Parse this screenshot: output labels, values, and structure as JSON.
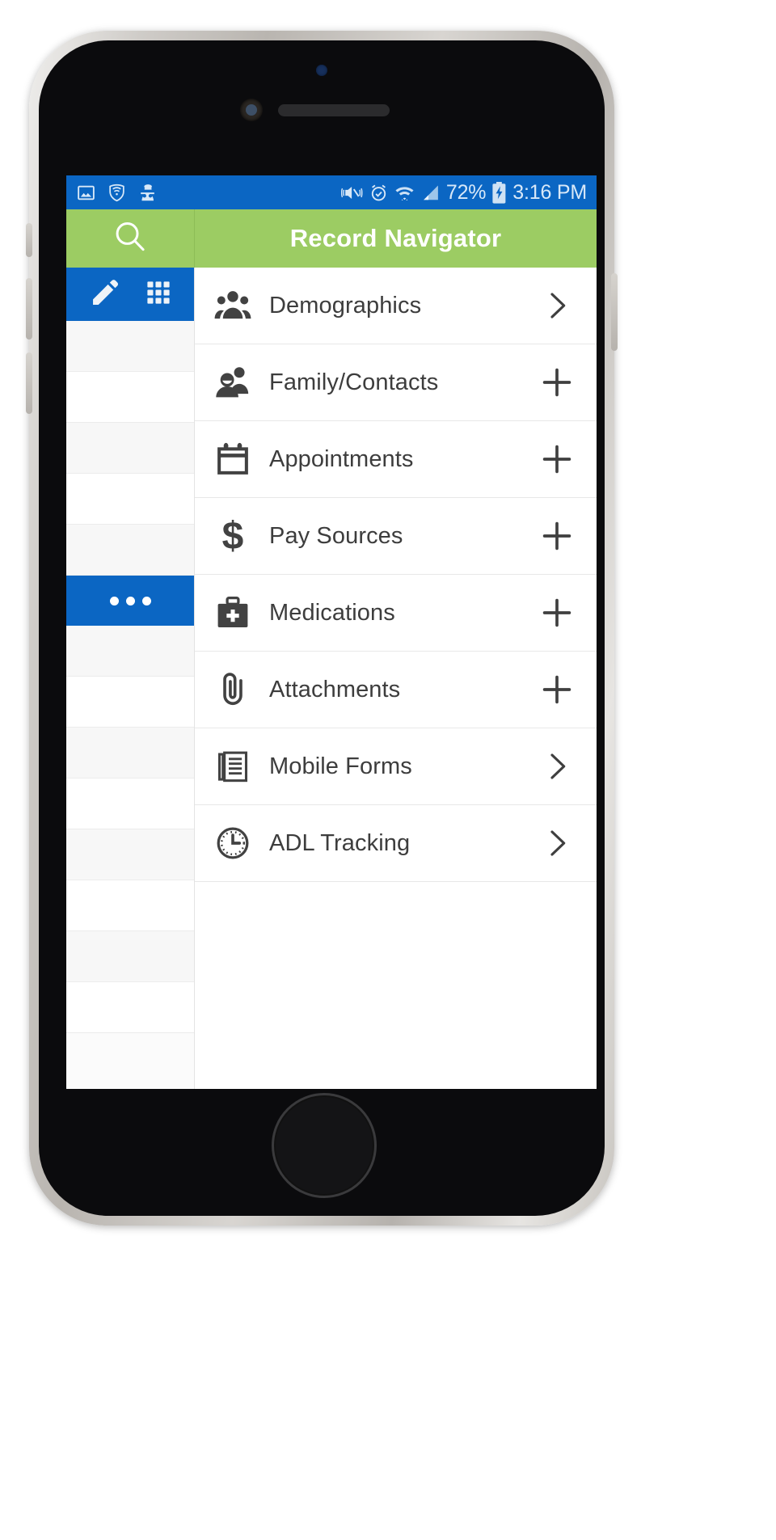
{
  "device": {
    "name": "smartphone-mockup"
  },
  "status_bar": {
    "background": "#0b66c3",
    "left_icons": [
      {
        "name": "screenshot-image-icon"
      },
      {
        "name": "vpn-shield-icon"
      },
      {
        "name": "incognito-icon"
      }
    ],
    "right_icons": [
      {
        "name": "vibrate-mute-icon"
      },
      {
        "name": "alarm-clock-icon"
      },
      {
        "name": "wifi-icon"
      },
      {
        "name": "cellular-signal-icon"
      }
    ],
    "battery_percent": "72%",
    "battery_state_icon": "battery-charging-icon",
    "clock": "3:16 PM"
  },
  "app_bar": {
    "background": "#9ccc63",
    "search_icon": "search-icon",
    "title": "Record Navigator"
  },
  "sidebar": {
    "background": "#fbfbfb",
    "toolbar": {
      "background": "#0b66c3",
      "buttons": [
        {
          "name": "edit-pencil-icon"
        },
        {
          "name": "grid-apps-icon"
        }
      ]
    },
    "rows": [
      {
        "type": "blank"
      },
      {
        "type": "blank"
      },
      {
        "type": "blank"
      },
      {
        "type": "blank"
      },
      {
        "type": "blank"
      },
      {
        "type": "overflow",
        "label": "•••"
      },
      {
        "type": "blank"
      },
      {
        "type": "blank"
      },
      {
        "type": "blank"
      },
      {
        "type": "blank"
      },
      {
        "type": "blank"
      },
      {
        "type": "blank"
      },
      {
        "type": "blank"
      },
      {
        "type": "blank"
      }
    ]
  },
  "nav_list": {
    "items": [
      {
        "label": "Demographics",
        "icon": "people-group-icon",
        "affordance": "chevron-right-icon"
      },
      {
        "label": "Family/Contacts",
        "icon": "two-people-icon",
        "affordance": "plus-icon"
      },
      {
        "label": "Appointments",
        "icon": "calendar-icon",
        "affordance": "plus-icon"
      },
      {
        "label": "Pay Sources",
        "icon": "dollar-sign-icon",
        "affordance": "plus-icon"
      },
      {
        "label": "Medications",
        "icon": "medical-kit-icon",
        "affordance": "plus-icon"
      },
      {
        "label": "Attachments",
        "icon": "paperclip-icon",
        "affordance": "plus-icon"
      },
      {
        "label": "Mobile Forms",
        "icon": "document-lines-icon",
        "affordance": "chevron-right-icon"
      },
      {
        "label": "ADL Tracking",
        "icon": "clock-icon",
        "affordance": "chevron-right-icon"
      }
    ]
  },
  "colors": {
    "accent_blue": "#0b66c3",
    "accent_green": "#9ccc63",
    "text_dark": "#3d3d3d"
  }
}
